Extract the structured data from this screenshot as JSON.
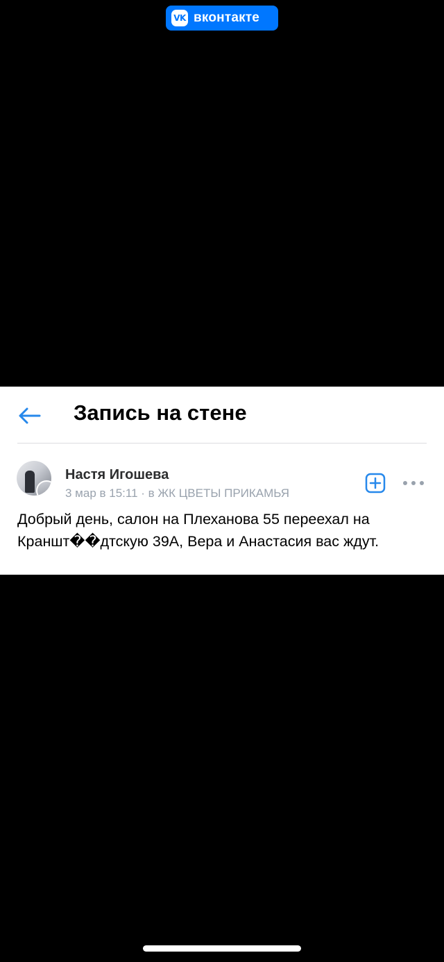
{
  "app_badge": {
    "logo_text": "VK",
    "name": "вконтакте",
    "color": "#0077FF"
  },
  "header": {
    "back_icon": "arrow-left-icon",
    "title": "Запись на стене"
  },
  "post": {
    "author": "Настя Игошева",
    "meta": "3 мар в 15:11 · в ЖК ЦВЕТЫ ПРИКАМЬЯ",
    "text_line1": "Добрый день, салон на Плеханова 55 переехал на",
    "text_line2": "Краншт��дтскую 39А, Вера и Анастасия вас ждут.",
    "add_icon": "plus-square-icon",
    "more_icon": "more-horizontal-icon"
  },
  "colors": {
    "accent": "#0077FF",
    "back_arrow": "#2688EB",
    "muted_text": "#99A2AD",
    "card_bg": "#FFFFFF",
    "screen_bg": "#000000"
  }
}
